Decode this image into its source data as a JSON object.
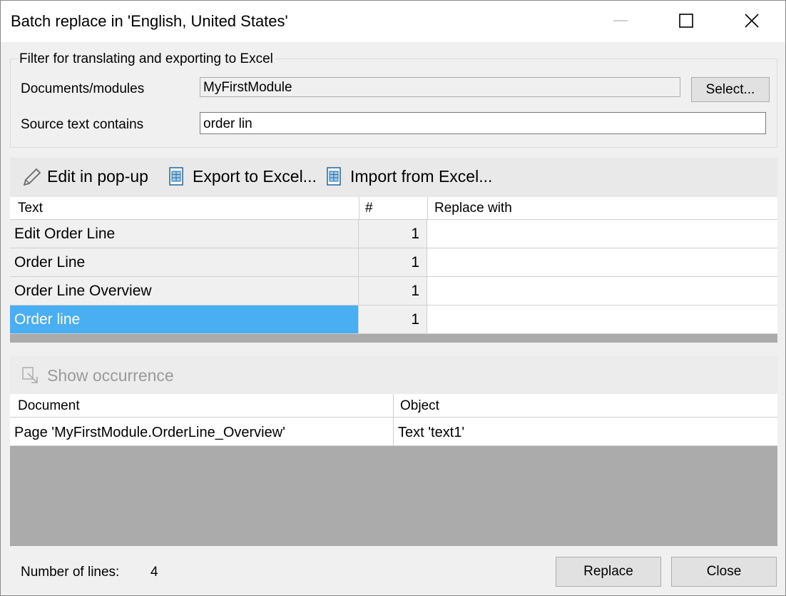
{
  "window": {
    "title": "Batch replace in 'English, United States'",
    "minimize_icon": "minimize-icon",
    "maximize_icon": "maximize-icon",
    "close_icon": "close-icon"
  },
  "filter": {
    "legend": "Filter for translating and exporting to Excel",
    "documents_label": "Documents/modules",
    "documents_value": "MyFirstModule",
    "select_button": "Select...",
    "source_label": "Source text contains",
    "source_value": "order lin"
  },
  "toolbar": {
    "edit_label": "Edit in pop-up",
    "edit_icon": "pencil-icon",
    "export_label": "Export to Excel...",
    "export_icon": "excel-export-icon",
    "import_label": "Import from Excel...",
    "import_icon": "excel-import-icon"
  },
  "texts_grid": {
    "columns": [
      "Text",
      "#",
      "Replace with"
    ],
    "rows": [
      {
        "text": "Edit Order Line",
        "count": "1",
        "replace": ""
      },
      {
        "text": "Order Line",
        "count": "1",
        "replace": ""
      },
      {
        "text": "Order Line Overview",
        "count": "1",
        "replace": ""
      },
      {
        "text": "Order line",
        "count": "1",
        "replace": "",
        "selected": true
      }
    ]
  },
  "occurrence": {
    "button_label": "Show occurrence",
    "icon": "show-occurrence-icon",
    "columns": [
      "Document",
      "Object"
    ],
    "rows": [
      {
        "document": "Page 'MyFirstModule.OrderLine_Overview'",
        "object": "Text 'text1'"
      }
    ]
  },
  "footer": {
    "lines_label": "Number of lines:",
    "lines_value": "4",
    "replace_button": "Replace",
    "close_button": "Close"
  },
  "colors": {
    "selection": "#4aaff2",
    "background": "#f0f0f0",
    "grid_empty": "#ababab"
  }
}
